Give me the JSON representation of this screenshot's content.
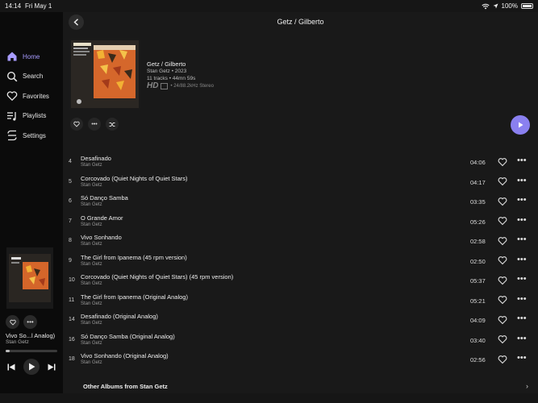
{
  "status": {
    "time": "14:14",
    "date": "Fri May 1",
    "battery": "100%"
  },
  "sidebar": {
    "items": [
      {
        "label": "Home",
        "icon": "home-icon",
        "active": true
      },
      {
        "label": "Search",
        "icon": "search-icon",
        "active": false
      },
      {
        "label": "Favorites",
        "icon": "heart-icon",
        "active": false
      },
      {
        "label": "Playlists",
        "icon": "playlist-icon",
        "active": false
      },
      {
        "label": "Settings",
        "icon": "settings-icon",
        "active": false
      }
    ]
  },
  "now_playing": {
    "title": "Vivo So...l Analog)",
    "artist": "Stan Getz",
    "progress": 0.08
  },
  "header": {
    "title": "Getz / Gilberto"
  },
  "album": {
    "title": "Getz / Gilberto",
    "subtitle": "Stan Getz • 2023",
    "meta": "11 tracks • 44mn 59s",
    "hd_label": "HD",
    "quality": "• 24/88.2kHz Stereo"
  },
  "tracks": [
    {
      "num": "4",
      "title": "Desafinado",
      "artist": "Stan Getz",
      "duration": "04:06"
    },
    {
      "num": "5",
      "title": "Corcovado (Quiet Nights of Quiet Stars)",
      "artist": "Stan Getz",
      "duration": "04:17"
    },
    {
      "num": "6",
      "title": "Só Danço Samba",
      "artist": "Stan Getz",
      "duration": "03:35"
    },
    {
      "num": "7",
      "title": "O Grande Amor",
      "artist": "Stan Getz",
      "duration": "05:26"
    },
    {
      "num": "8",
      "title": "Vivo Sonhando",
      "artist": "Stan Getz",
      "duration": "02:58"
    },
    {
      "num": "9",
      "title": "The Girl from Ipanema (45 rpm version)",
      "artist": "Stan Getz",
      "duration": "02:50"
    },
    {
      "num": "10",
      "title": "Corcovado (Quiet Nights of Quiet Stars) (45 rpm version)",
      "artist": "Stan Getz",
      "duration": "05:37"
    },
    {
      "num": "11",
      "title": "The Girl from Ipanema (Original Analog)",
      "artist": "Stan Getz",
      "duration": "05:21"
    },
    {
      "num": "14",
      "title": "Desafinado (Original Analog)",
      "artist": "Stan Getz",
      "duration": "04:09"
    },
    {
      "num": "16",
      "title": "Só Danço Samba (Original Analog)",
      "artist": "Stan Getz",
      "duration": "03:40"
    },
    {
      "num": "18",
      "title": "Vivo Sonhando (Original Analog)",
      "artist": "Stan Getz",
      "duration": "02:56"
    }
  ],
  "footer": {
    "other_albums": "Other Albums from Stan Getz"
  },
  "colors": {
    "accent": "#a79bff",
    "play_button": "#8a80f0",
    "background": "#191919",
    "sidebar": "#0b0b0b"
  }
}
